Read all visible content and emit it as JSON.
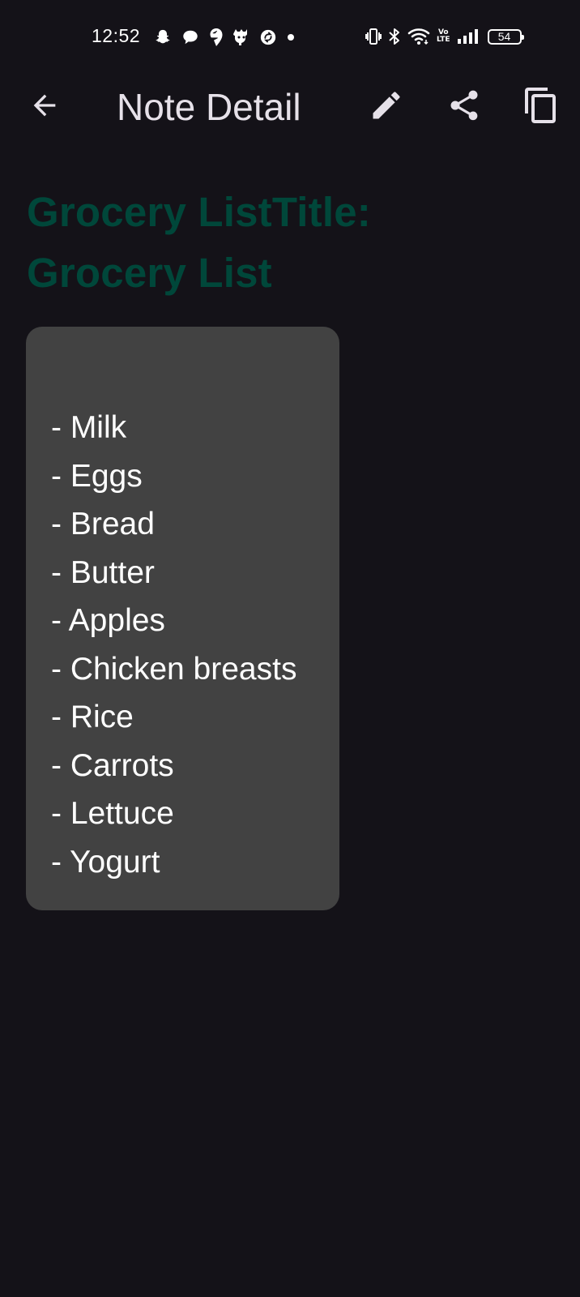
{
  "status_bar": {
    "time": "12:52",
    "battery_level": "54",
    "notification_icons": [
      "snapchat-icon",
      "chat-bubble-icon",
      "swiggy-icon",
      "notification-app-icon",
      "sync-app-icon",
      "more-dot-icon"
    ],
    "system_icons": [
      "vibrate-icon",
      "bluetooth-icon",
      "wifi-icon",
      "volte-icon",
      "signal-icon",
      "battery-icon"
    ],
    "volte_top": "Vo",
    "volte_bottom": "LTE"
  },
  "app_bar": {
    "title": "Note Detail",
    "actions": [
      "back-arrow-icon",
      "edit-pencil-icon",
      "share-icon",
      "copy-icon"
    ]
  },
  "note": {
    "title_prefix": " Grocery List",
    "title_rest": "Title: Grocery List",
    "lines": [
      "- Milk",
      "- Eggs",
      "- Bread",
      "- Butter",
      "- Apples",
      "- Chicken breasts",
      "- Rice",
      "- Carrots",
      "- Lettuce",
      "- Yogurt"
    ]
  },
  "colors": {
    "background": "#141218",
    "title": "#00473a",
    "card": "#424242",
    "icon": "#e6e1e9"
  }
}
